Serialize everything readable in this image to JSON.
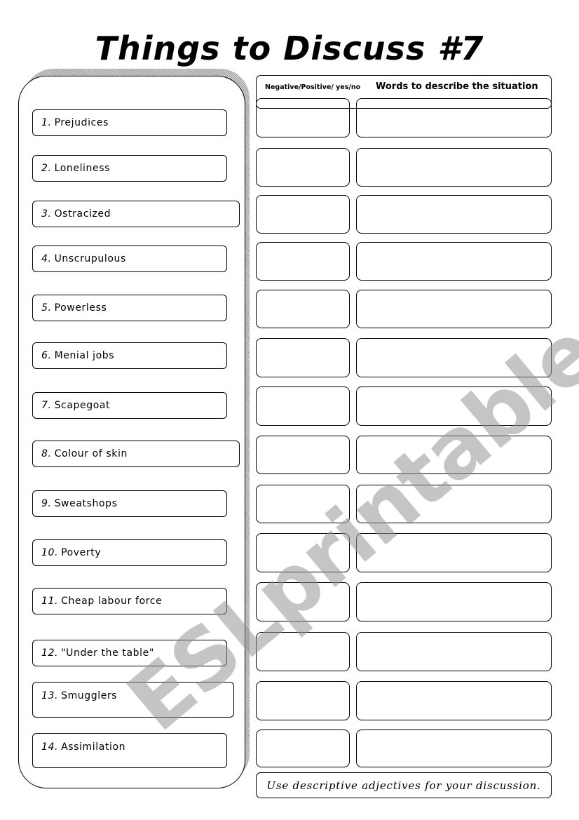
{
  "title": "Things to Discuss #7",
  "header": {
    "col1": "Negative/Positive/ yes/no",
    "col2": "Words to describe the situation"
  },
  "terms": [
    {
      "num": "1.",
      "label": "Prejudices"
    },
    {
      "num": "2.",
      "label": "Loneliness"
    },
    {
      "num": "3.",
      "label": "Ostracized"
    },
    {
      "num": "4.",
      "label": "Unscrupulous"
    },
    {
      "num": "5.",
      "label": "Powerless"
    },
    {
      "num": "6.",
      "label": "Menial jobs"
    },
    {
      "num": "7.",
      "label": "Scapegoat"
    },
    {
      "num": "8.",
      "label": "Colour of skin"
    },
    {
      "num": "9.",
      "label": "Sweatshops"
    },
    {
      "num": "10.",
      "label": "Poverty"
    },
    {
      "num": "11.",
      "label": "Cheap labour force"
    },
    {
      "num": "12.",
      "label": "\"Under the table\""
    },
    {
      "num": "13.",
      "label": "Smugglers"
    },
    {
      "num": "14.",
      "label": "Assimilation"
    }
  ],
  "footer": "Use descriptive adjectives for your discussion.",
  "watermark": "ESLprintables.com"
}
